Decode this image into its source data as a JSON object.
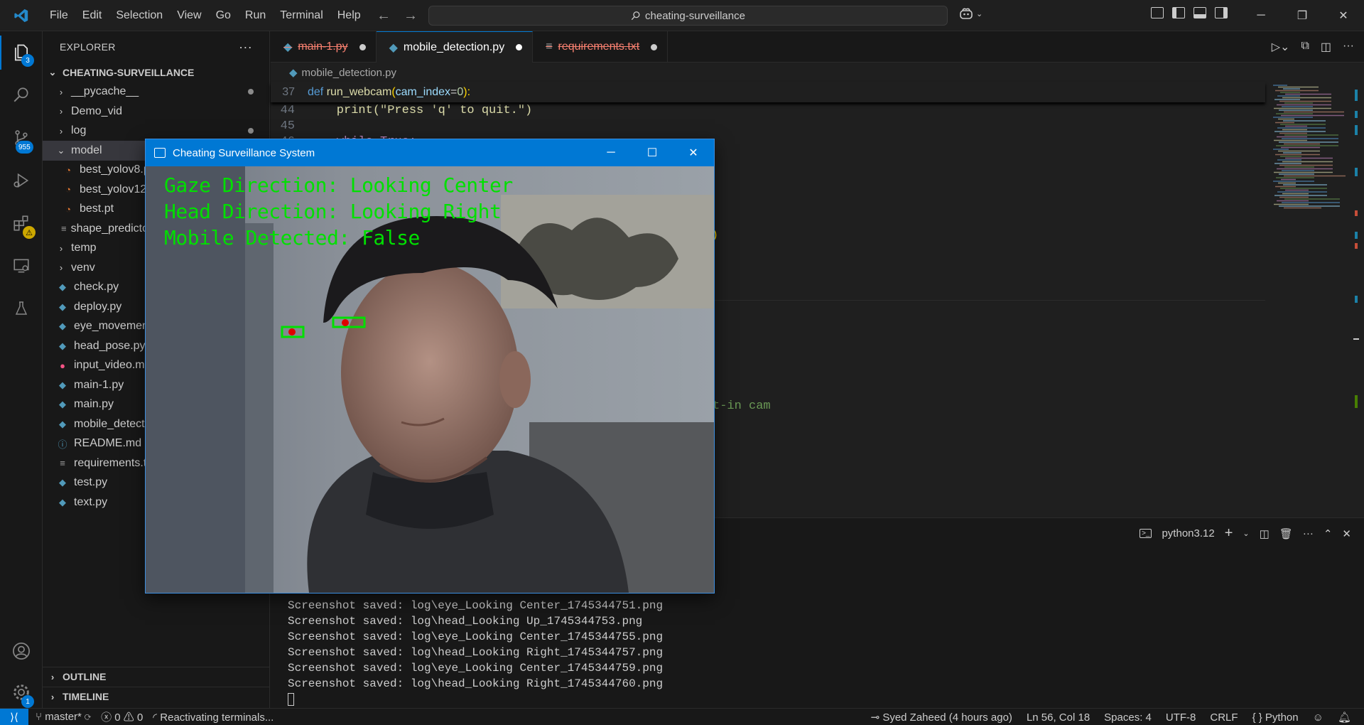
{
  "titlebar": {
    "menu": [
      "File",
      "Edit",
      "Selection",
      "View",
      "Go",
      "Run",
      "Terminal",
      "Help"
    ],
    "search_text": "cheating-surveillance"
  },
  "activity": {
    "explorer_badge": "3",
    "scm_badge": "955",
    "accounts_badge": "1"
  },
  "sidebar": {
    "title": "EXPLORER",
    "more": "···",
    "root": "CHEATING-SURVEILLANCE",
    "items": [
      {
        "label": "__pycache__",
        "type": "folder",
        "open": false,
        "depth": 1,
        "dot": true
      },
      {
        "label": "Demo_vid",
        "type": "folder",
        "open": false,
        "depth": 1,
        "dot": false
      },
      {
        "label": "log",
        "type": "folder",
        "open": false,
        "depth": 1,
        "dot": true
      },
      {
        "label": "model",
        "type": "folder",
        "open": true,
        "depth": 1,
        "dot": true,
        "selected": true
      },
      {
        "label": "best_yolov8.pt",
        "type": "rss",
        "depth": 2
      },
      {
        "label": "best_yolov12.pt",
        "type": "rss",
        "depth": 2
      },
      {
        "label": "best.pt",
        "type": "rss",
        "depth": 2
      },
      {
        "label": "shape_predictor_68_face_landmarks.dat",
        "type": "lines",
        "depth": 2
      },
      {
        "label": "temp",
        "type": "folder",
        "open": false,
        "depth": 1
      },
      {
        "label": "venv",
        "type": "folder",
        "open": false,
        "depth": 1
      },
      {
        "label": "check.py",
        "type": "py",
        "depth": 1
      },
      {
        "label": "deploy.py",
        "type": "py",
        "depth": 1
      },
      {
        "label": "eye_movement.py",
        "type": "py",
        "depth": 1
      },
      {
        "label": "head_pose.py",
        "type": "py",
        "depth": 1
      },
      {
        "label": "input_video.mp4",
        "type": "video",
        "depth": 1
      },
      {
        "label": "main-1.py",
        "type": "py",
        "depth": 1
      },
      {
        "label": "main.py",
        "type": "py",
        "depth": 1
      },
      {
        "label": "mobile_detection.py",
        "type": "py",
        "depth": 1
      },
      {
        "label": "README.md",
        "type": "info",
        "depth": 1
      },
      {
        "label": "requirements.txt",
        "type": "lines",
        "depth": 1
      },
      {
        "label": "test.py",
        "type": "py",
        "depth": 1
      },
      {
        "label": "text.py",
        "type": "py",
        "depth": 1
      }
    ],
    "outline": "OUTLINE",
    "timeline": "TIMELINE"
  },
  "editor": {
    "tabs": [
      {
        "label": "main-1.py",
        "state": "error",
        "modified": true
      },
      {
        "label": "mobile_detection.py",
        "state": "active",
        "modified": true
      },
      {
        "label": "requirements.txt",
        "state": "error",
        "modified": true
      }
    ],
    "breadcrumb": "mobile_detection.py",
    "sticky": {
      "num": "37",
      "def": "def",
      "name": "run_webcam",
      "param": "cam_index",
      "eq": "=",
      "val": "0",
      "end": "):"
    },
    "lines": [
      {
        "num": "44",
        "code": "    print(\"Press 'q' to quit.\")"
      },
      {
        "num": "45",
        "code": ""
      },
      {
        "num": "46",
        "code": "    while True:"
      }
    ],
    "hidden_fragment_1": ")",
    "hidden_fragment_2": "t-in cam"
  },
  "panel": {
    "shell": "python3.12",
    "terminal_lines": [
      "Screenshot saved: log\\eye_Looking Center_1745344751.png",
      "Screenshot saved: log\\head_Looking Up_1745344753.png",
      "Screenshot saved: log\\eye_Looking Center_1745344755.png",
      "Screenshot saved: log\\head_Looking Right_1745344757.png",
      "Screenshot saved: log\\eye_Looking Center_1745344759.png",
      "Screenshot saved: log\\head_Looking Right_1745344760.png"
    ]
  },
  "opencv_window": {
    "title": "Cheating Surveillance System",
    "overlay": [
      "Gaze Direction: Looking Center",
      "Head Direction: Looking Right",
      "Mobile Detected: False"
    ]
  },
  "statusbar": {
    "branch": "master*",
    "errors": "0",
    "warnings": "0",
    "task": "Reactivating terminals...",
    "blame": "Syed Zaheed (4 hours ago)",
    "position": "Ln 56, Col 18",
    "spaces": "Spaces: 4",
    "encoding": "UTF-8",
    "eol": "CRLF",
    "language": "Python"
  },
  "colors": {
    "accent": "#0078d4",
    "overlay_green": "#00e000",
    "eye_box": "#00e000",
    "pupil": "#e00000"
  }
}
